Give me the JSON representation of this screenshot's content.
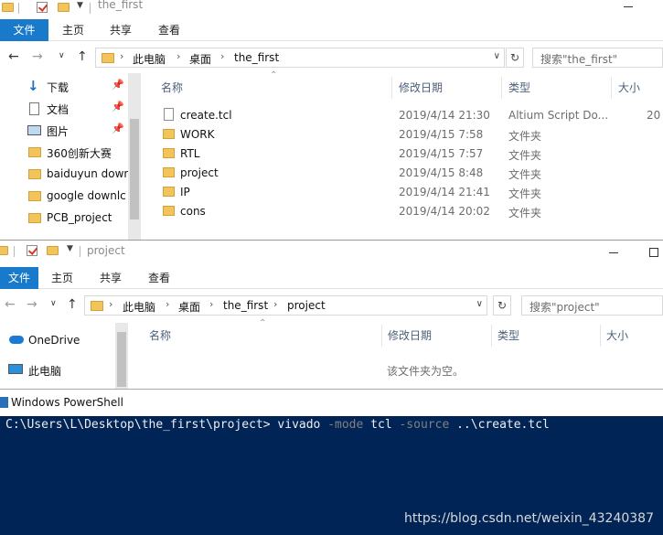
{
  "win1": {
    "title": "the_first",
    "tabs": [
      "文件",
      "主页",
      "共享",
      "查看"
    ],
    "address": [
      "此电脑",
      "桌面",
      "the_first"
    ],
    "search_placeholder": "搜索\"the_first\"",
    "sidebar": [
      {
        "label": "下载",
        "icon": "download-icon",
        "pinned": true
      },
      {
        "label": "文档",
        "icon": "document-icon",
        "pinned": true
      },
      {
        "label": "图片",
        "icon": "pictures-icon",
        "pinned": true
      },
      {
        "label": "360创新大赛",
        "icon": "folder-icon",
        "pinned": false
      },
      {
        "label": "baiduyun down",
        "icon": "folder-icon",
        "pinned": false
      },
      {
        "label": "google downlc",
        "icon": "folder-icon",
        "pinned": false
      },
      {
        "label": "PCB_project",
        "icon": "folder-icon",
        "pinned": false
      }
    ],
    "columns": {
      "name": "名称",
      "date": "修改日期",
      "type": "类型",
      "size": "大小"
    },
    "files": [
      {
        "name": "create.tcl",
        "date": "2019/4/14 21:30",
        "type": "Altium Script Do...",
        "size": "20",
        "kind": "file"
      },
      {
        "name": "WORK",
        "date": "2019/4/15 7:58",
        "type": "文件夹",
        "size": "",
        "kind": "folder"
      },
      {
        "name": "RTL",
        "date": "2019/4/15 7:57",
        "type": "文件夹",
        "size": "",
        "kind": "folder"
      },
      {
        "name": "project",
        "date": "2019/4/15 8:48",
        "type": "文件夹",
        "size": "",
        "kind": "folder"
      },
      {
        "name": "IP",
        "date": "2019/4/14 21:41",
        "type": "文件夹",
        "size": "",
        "kind": "folder"
      },
      {
        "name": "cons",
        "date": "2019/4/14 20:02",
        "type": "文件夹",
        "size": "",
        "kind": "folder"
      }
    ]
  },
  "win2": {
    "title": "project",
    "tabs": [
      "文件",
      "主页",
      "共享",
      "查看"
    ],
    "address": [
      "此电脑",
      "桌面",
      "the_first",
      "project"
    ],
    "search_placeholder": "搜索\"project\"",
    "sidebar": [
      {
        "label": "OneDrive",
        "icon": "onedrive-icon"
      },
      {
        "label": "此电脑",
        "icon": "computer-icon"
      }
    ],
    "columns": {
      "name": "名称",
      "date": "修改日期",
      "type": "类型",
      "size": "大小"
    },
    "empty_message": "该文件夹为空。"
  },
  "powershell": {
    "title": "Windows PowerShell",
    "prompt": "C:\\Users\\L\\Desktop\\the_first\\project> vivado ",
    "param1": "-mode",
    "arg1": " tcl ",
    "param2": "-source",
    "arg2": " ..\\create.tcl",
    "bg_color": "#012456"
  },
  "watermark": "https://blog.csdn.net/weixin_43240387"
}
